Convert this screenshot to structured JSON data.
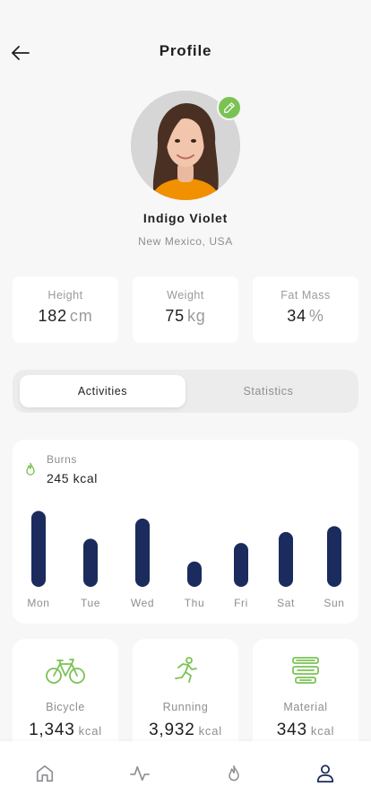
{
  "header": {
    "title": "Profile",
    "back_icon": "arrow-left-icon"
  },
  "profile": {
    "name": "Indigo Violet",
    "location": "New Mexico, USA",
    "edit_icon": "pencil-icon"
  },
  "stats": [
    {
      "label": "Height",
      "value": "182",
      "unit": "cm"
    },
    {
      "label": "Weight",
      "value": "75",
      "unit": "kg"
    },
    {
      "label": "Fat Mass",
      "value": "34",
      "unit": "%"
    }
  ],
  "tabs": [
    {
      "label": "Activities",
      "active": true
    },
    {
      "label": "Statistics",
      "active": false
    }
  ],
  "burns": {
    "label": "Burns",
    "value": "245 kcal",
    "icon": "flame-icon"
  },
  "chart_data": {
    "type": "bar",
    "categories": [
      "Mon",
      "Tue",
      "Wed",
      "Thu",
      "Fri",
      "Sat",
      "Sun"
    ],
    "values": [
      90,
      57,
      81,
      30,
      52,
      65,
      72
    ],
    "ylim": [
      0,
      100
    ],
    "grid": false,
    "bar_color": "#1b2b5e"
  },
  "activities": [
    {
      "label": "Bicycle",
      "value": "1,343",
      "unit": "kcal",
      "icon": "bicycle-icon"
    },
    {
      "label": "Running",
      "value": "3,932",
      "unit": "kcal",
      "icon": "running-icon"
    },
    {
      "label": "Material",
      "value": "343",
      "unit": "kcal",
      "icon": "dumbbell-icon"
    }
  ],
  "bottom_nav": [
    {
      "icon": "home-icon",
      "active": false
    },
    {
      "icon": "activity-icon",
      "active": false
    },
    {
      "icon": "flame-icon",
      "active": false
    },
    {
      "icon": "user-icon",
      "active": true
    }
  ],
  "colors": {
    "accent_green": "#7bc254",
    "navy": "#1b2b5e",
    "muted": "#8e8e93"
  }
}
